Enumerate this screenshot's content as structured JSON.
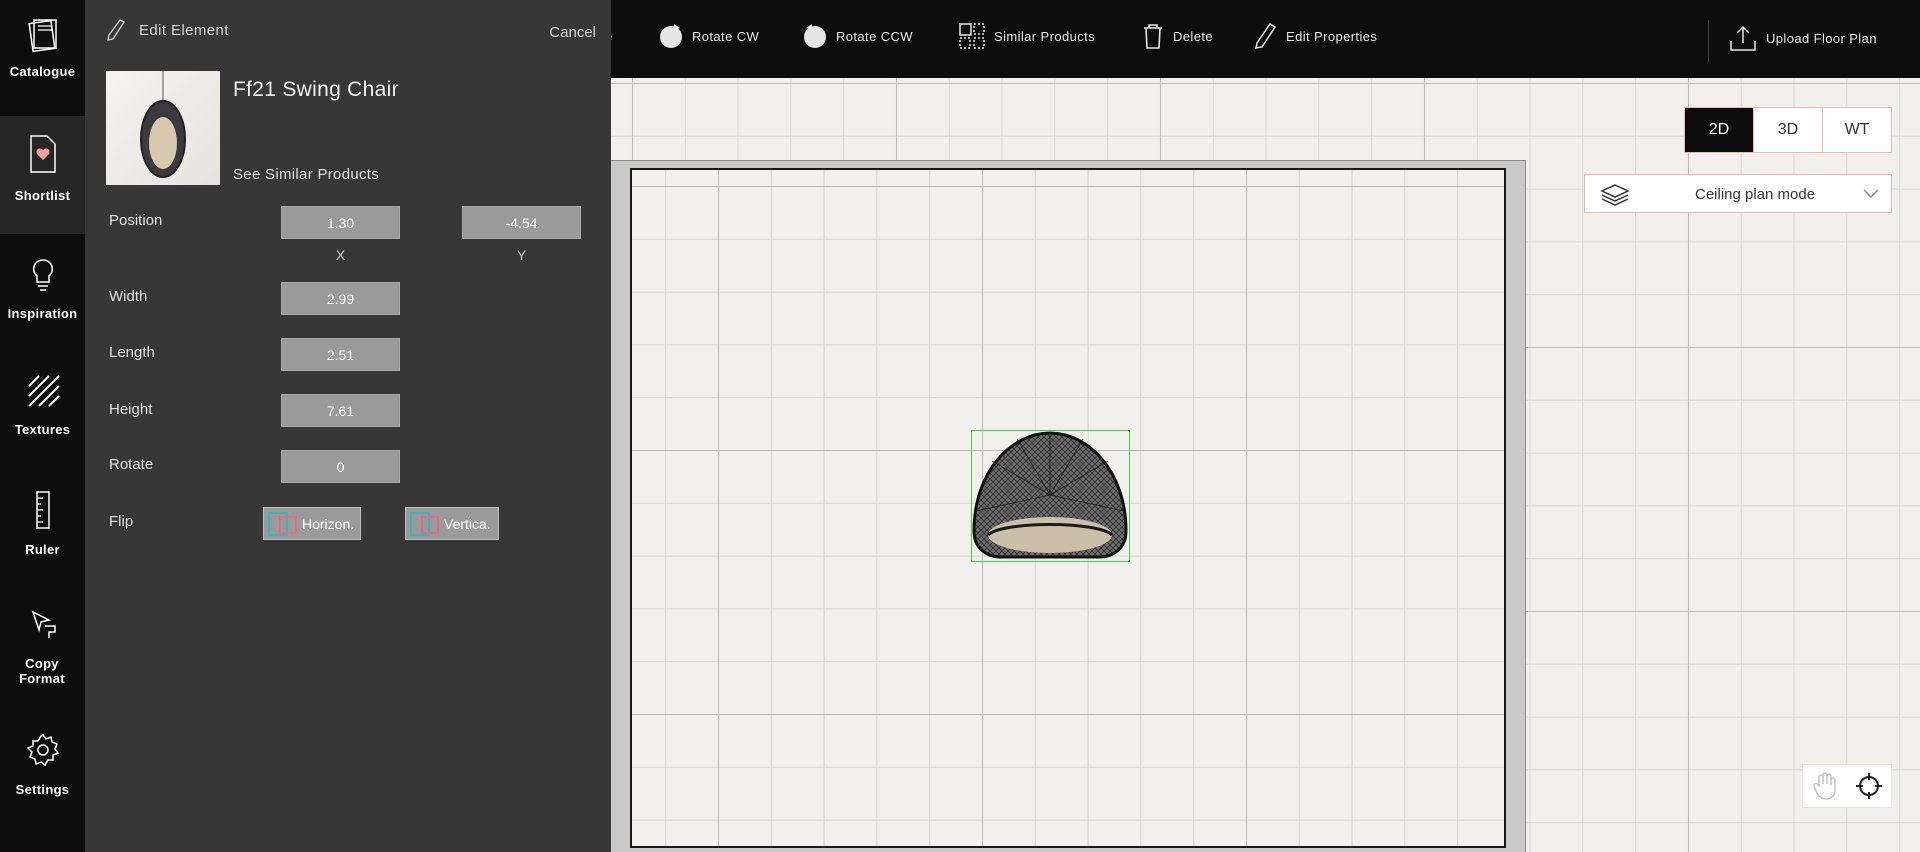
{
  "nav": {
    "items": [
      {
        "label": "Catalogue",
        "icon": "catalogue-icon"
      },
      {
        "label": "Shortlist",
        "icon": "shortlist-heart-icon"
      },
      {
        "label": "Inspiration",
        "icon": "lightbulb-icon"
      },
      {
        "label": "Textures",
        "icon": "texture-icon"
      },
      {
        "label": "Ruler",
        "icon": "ruler-icon"
      },
      {
        "label": "Copy Format",
        "icon": "copy-format-icon"
      },
      {
        "label": "Settings",
        "icon": "gear-icon"
      }
    ]
  },
  "toolbar": {
    "partial_label": "e",
    "rotate_cw": "Rotate CW",
    "rotate_ccw": "Rotate CCW",
    "similar_products": "Similar Products",
    "delete": "Delete",
    "edit_properties": "Edit Properties",
    "upload_floor_plan": "Upload Floor Plan"
  },
  "view_toggle": {
    "options": [
      "2D",
      "3D",
      "WT"
    ],
    "selected": "2D"
  },
  "mode_select": {
    "value": "Ceiling plan mode"
  },
  "panel": {
    "title": "Edit Element",
    "cancel": "Cancel",
    "product_name": "Ff21 Swing Chair",
    "see_similar": "See Similar Products",
    "position_label": "Position",
    "position_x": "1.30",
    "position_y": "-4.54",
    "x_label": "X",
    "y_label": "Y",
    "width_label": "Width",
    "width": "2.99",
    "length_label": "Length",
    "length": "2.51",
    "height_label": "Height",
    "height": "7.61",
    "rotate_label": "Rotate",
    "rotate": "0",
    "flip_label": "Flip",
    "flip_horizontal": "Horizon.",
    "flip_vertical": "Vertica."
  },
  "colors": {
    "accent_selection": "#43d143",
    "nav_bg": "#0d0d0d",
    "panel_bg": "#373737"
  }
}
